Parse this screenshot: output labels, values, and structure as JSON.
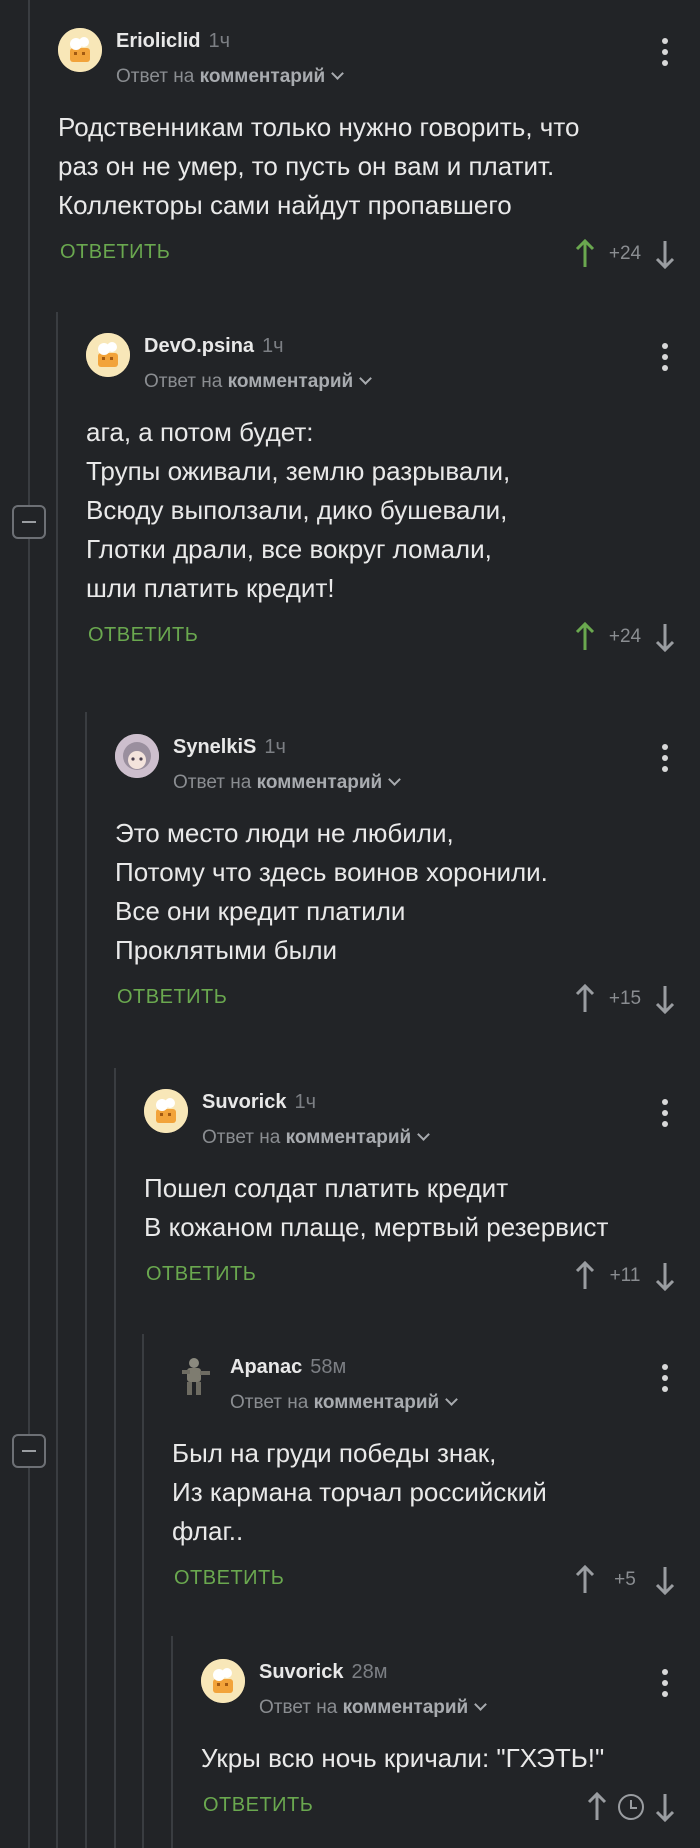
{
  "labels": {
    "reply_to": "Ответ на",
    "comment": "комментарий",
    "reply": "ОТВЕТИТЬ"
  },
  "colors": {
    "background": "#222427",
    "accent_green": "#6aa84f",
    "vote_up_active": "#6aa84f",
    "muted": "#8a8d91"
  },
  "comments": [
    {
      "user": "Erioliclid",
      "time": "1ч",
      "avatar": "pikabu-default-icon",
      "text": "Родственникам только нужно говорить, что\nраз он не умер, то пусть он вам и платит.\nКоллекторы сами найдут пропавшего",
      "score": "+24",
      "upvoted": true
    },
    {
      "user": "DevO.psina",
      "time": "1ч",
      "avatar": "pikabu-default-icon",
      "text": "ага, а потом будет:\nТрупы оживали, землю разрывали,\nВсюду выползали, дико бушевали,\nГлотки драли, все вокруг ломали,\nшли платить кредит!",
      "score": "+24",
      "upvoted": true
    },
    {
      "user": "SynelkiS",
      "time": "1ч",
      "avatar": "anime-avatar-icon",
      "text": "Это место люди не любили,\nПотому что здесь воинов хоронили.\nВсе они кредит платили\nПроклятыми были",
      "score": "+15",
      "upvoted": false
    },
    {
      "user": "Suvorick",
      "time": "1ч",
      "avatar": "pikabu-default-icon",
      "text": "Пошел солдат платить кредит\nВ кожаном плаще, мертвый резервист",
      "score": "+11",
      "upvoted": false
    },
    {
      "user": "Apanac",
      "time": "58м",
      "avatar": "soldier-avatar-icon",
      "text": "Был на груди победы знак,\nИз кармана торчал российский\nфлаг..",
      "score": "+5",
      "upvoted": false
    },
    {
      "user": "Suvorick",
      "time": "28м",
      "avatar": "pikabu-default-icon",
      "text": "Укры всю ночь кричали: \"ГХЭТЬ!\"",
      "score": "",
      "upvoted": false,
      "pending": true
    }
  ]
}
